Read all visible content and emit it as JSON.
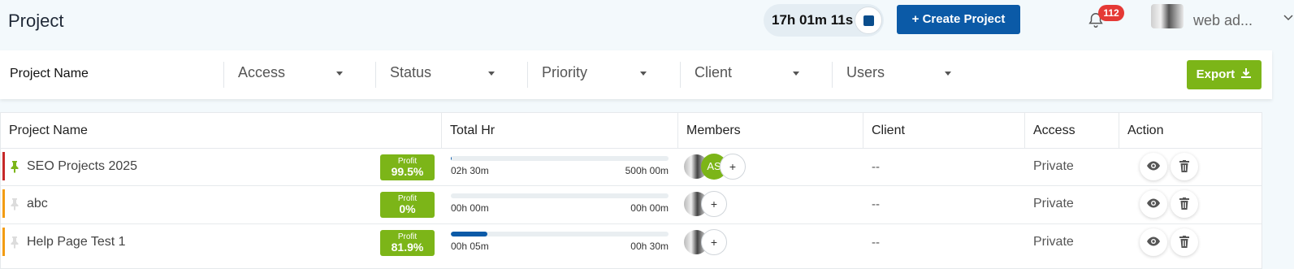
{
  "header": {
    "title": "Project",
    "timer": "17h 01m 11s",
    "create_label": "+ Create Project",
    "notification_count": "112",
    "user_name": "web ad..."
  },
  "filters": {
    "search_label": "Project Name",
    "dropdowns": [
      "Access",
      "Status",
      "Priority",
      "Client",
      "Users"
    ],
    "export_label": "Export"
  },
  "table": {
    "columns": [
      "Project Name",
      "Total Hr",
      "Members",
      "Client",
      "Access",
      "Action"
    ],
    "rows": [
      {
        "name": "SEO Projects 2025",
        "pinned": true,
        "priority_color": "#c62828",
        "profit_label": "Profit",
        "profit_value": "99.5%",
        "hr_spent": "02h 30m",
        "hr_total": "500h 00m",
        "progress_fraction": 0.005,
        "member_initials": "AS",
        "client": "--",
        "access": "Private"
      },
      {
        "name": "abc",
        "pinned": false,
        "priority_color": "#f39c12",
        "profit_label": "Profit",
        "profit_value": "0%",
        "hr_spent": "00h 00m",
        "hr_total": "00h 00m",
        "progress_fraction": 0,
        "member_initials": "",
        "client": "--",
        "access": "Private"
      },
      {
        "name": "Help Page Test 1",
        "pinned": false,
        "priority_color": "#f39c12",
        "profit_label": "Profit",
        "profit_value": "81.9%",
        "hr_spent": "00h 05m",
        "hr_total": "00h 30m",
        "progress_fraction": 0.167,
        "member_initials": "",
        "client": "--",
        "access": "Private"
      }
    ]
  },
  "colors": {
    "primary": "#0b5aa7",
    "accent_green": "#7cb518",
    "badge_red": "#e53935"
  },
  "icons": [
    "stop-icon",
    "bell-icon",
    "chevron-down-icon",
    "download-icon",
    "pin-icon",
    "eye-icon",
    "trash-icon",
    "plus-icon"
  ]
}
